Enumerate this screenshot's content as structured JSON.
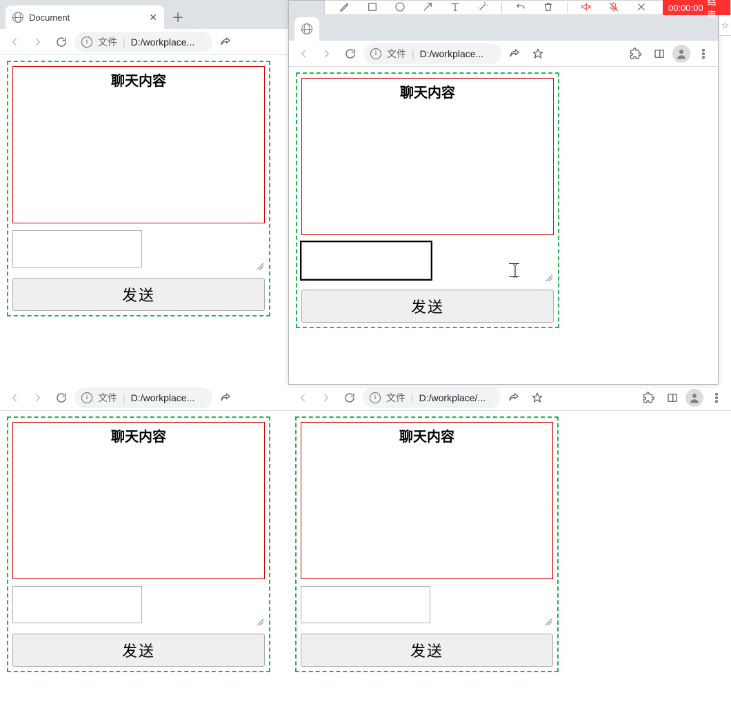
{
  "recording": {
    "timer": "00:00:00",
    "end_label": "结束"
  },
  "tab": {
    "title": "Document"
  },
  "address": {
    "scheme_label": "文件",
    "path_short": "D:/workplace...",
    "path_short2": "D:/workplace/..."
  },
  "chat": {
    "header": "聊天内容",
    "send_label": "发送",
    "input_value": ""
  }
}
